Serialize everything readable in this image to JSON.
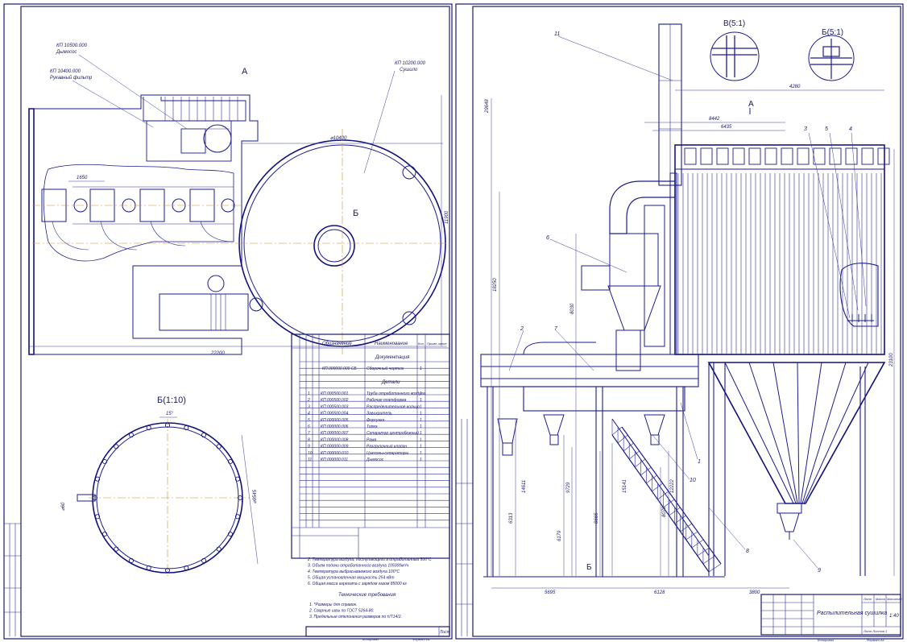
{
  "sheet_left": {
    "view_a_label": "А",
    "callouts": [
      {
        "code": "КП 10500.000",
        "name": "Дымосос"
      },
      {
        "code": "КП 10400.000",
        "name": "Рукавный фильтр"
      },
      {
        "code": "КП 10200.000",
        "name": "Сушило"
      }
    ],
    "dim_22200": "22200",
    "dim_11900": "11900",
    "dim_diam_10400": "⌀10400",
    "dim_1650": "1650",
    "label_b": "Б",
    "detail_b_title": "Б(1:10)",
    "dim_15deg": "15°",
    "dim_diam_9545": "⌀9545",
    "dim_diam_60": "⌀60",
    "tech_data": [
      "2. Температура воздуха, поступающего в отработанный  500°С",
      "3. Объем подачи отработанного воздуха          105000м³/ч",
      "4. Температура выбрасываемого воздуха            100°С",
      "5. Общая установленная мощность                 254 кВт",
      "6. Общая масса агрегата с зарядом газом         85000 кг"
    ],
    "tech_req_title": "Технические требования",
    "tech_req": [
      "1. *Размеры для справок.",
      "2. Сварные швы по ГОСТ 5264-80.",
      "3. Предельные отклонения размеров по ±IT14/2."
    ]
  },
  "spec_table": {
    "headers": [
      "Формат",
      "Зона",
      "Поз.",
      "Обозначение",
      "Наименование",
      "Кол.",
      "Приме-чание"
    ],
    "section_docs": "Документация",
    "doc_row": {
      "code": "КП.000000.000  СБ",
      "name": "Сборочный чертеж",
      "qty": "1"
    },
    "section_parts": "Детали",
    "rows": [
      {
        "pos": "1",
        "code": "КП.000500.001",
        "name": "Труба отработанного воздуха",
        "qty": "1"
      },
      {
        "pos": "2",
        "code": "КП.000500.002",
        "name": "Рабочая платформа",
        "qty": "1"
      },
      {
        "pos": "3",
        "code": "КП.000500.003",
        "name": "Распределительное кольцо",
        "qty": "1"
      },
      {
        "pos": "4",
        "code": "КП.000500.004",
        "name": "Завихритель",
        "qty": "1"
      },
      {
        "pos": "5",
        "code": "КП.000000.005",
        "name": "Форсунка",
        "qty": "1"
      },
      {
        "pos": "6",
        "code": "КП.000000.006",
        "name": "Топка",
        "qty": "1"
      },
      {
        "pos": "7",
        "code": "КП.000000.007",
        "name": "Сепаратор центробежный",
        "qty": "1"
      },
      {
        "pos": "8",
        "code": "КП.000000.008",
        "name": "Рама",
        "qty": "1"
      },
      {
        "pos": "9",
        "code": "КП.000000.009",
        "name": "Разгрузочный клапан",
        "qty": "1"
      },
      {
        "pos": "10",
        "code": "КП.000000.010",
        "name": "Циклоны-сепараторы",
        "qty": "1"
      },
      {
        "pos": "11",
        "code": "КП.000000.011",
        "name": "Дымосос",
        "qty": "1"
      }
    ],
    "sheet_label": "Лист",
    "copied": "Копировал",
    "format": "Формат  А1"
  },
  "sheet_right": {
    "detail_v": "В(5:1)",
    "detail_b": "Б(5:1)",
    "view_a": "А",
    "dims": {
      "d4280": "4280",
      "d8442": "8442",
      "d6435": "6435",
      "d29648": "29648",
      "d18250": "18250",
      "d8030": "8030",
      "d23100": "23100",
      "d14611": "14611",
      "d6313": "6313",
      "d6179": "6179",
      "d9729": "9729",
      "d8665": "8665",
      "d15141": "15141",
      "d12222": "12222",
      "d8070": "8070",
      "d5695": "5695",
      "d6128": "6128",
      "d3800": "3800"
    },
    "positions": [
      "11",
      "3",
      "5",
      "4",
      "6",
      "2",
      "7",
      "1",
      "10",
      "8",
      "9"
    ],
    "label_b": "Б",
    "title_block": {
      "title": "Распылительная сушилка",
      "sheet": "Лист",
      "sheets": "Листов",
      "mass": "Масса",
      "scale": "Масштаб",
      "scale_value": "1:40",
      "sheet_no": "Лист   Листов  1",
      "copied": "Копировал",
      "format": "Формат  А1"
    }
  },
  "colors": {
    "lines": "#1c1c8c",
    "axis": "#c8902a",
    "background": "#ffffff"
  }
}
